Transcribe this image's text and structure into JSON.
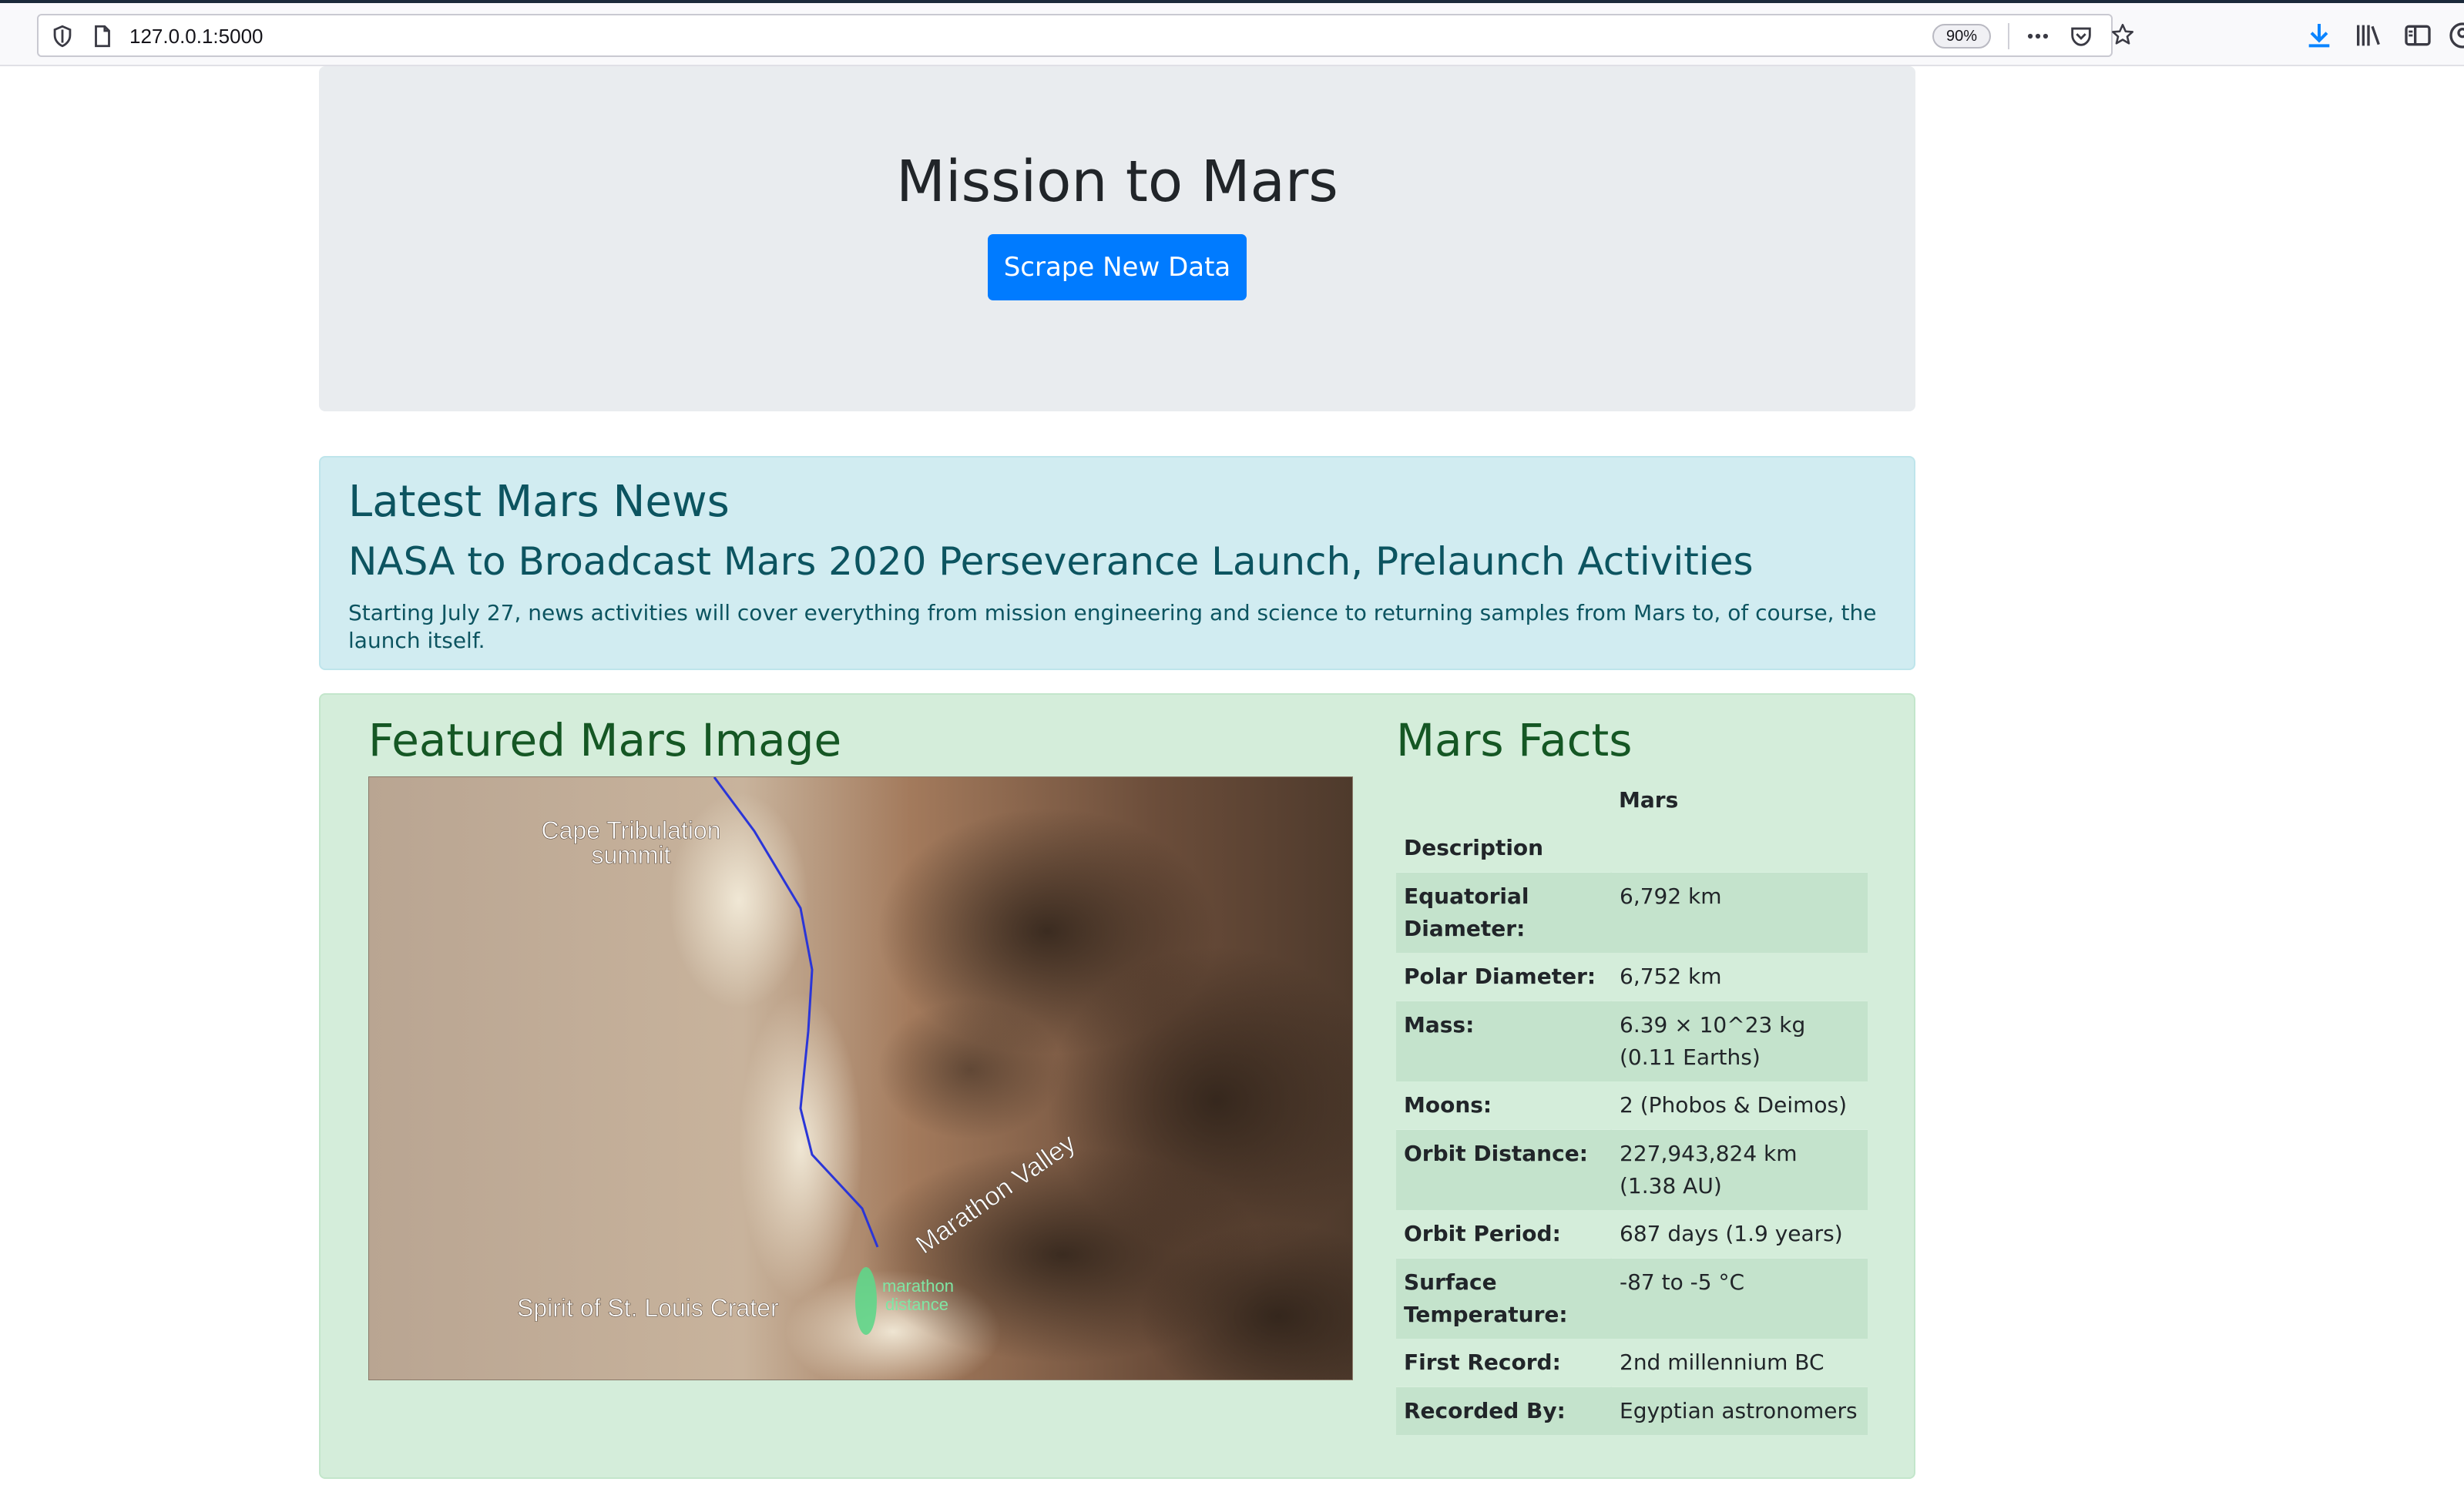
{
  "browser": {
    "url": "127.0.0.1:5000",
    "zoom": "90%",
    "icons": [
      "shield-icon",
      "page-icon",
      "more-icon",
      "pocket-icon",
      "star-icon",
      "download-icon",
      "library-icon",
      "sidebar-icon",
      "account-icon"
    ]
  },
  "header": {
    "title": "Mission to Mars",
    "scrape_label": "Scrape New Data",
    "button_color": "#007bff"
  },
  "news": {
    "heading": "Latest Mars News",
    "title": "NASA to Broadcast Mars 2020 Perseverance Launch, Prelaunch Activities",
    "teaser": "Starting July 27, news activities will cover everything from mission engineering and science to returning samples from Mars to, of course, the launch itself."
  },
  "featured": {
    "heading": "Featured Mars Image",
    "image_labels": {
      "cape": "Cape Tribulation",
      "summit": "summit",
      "valley": "Marathon Valley",
      "crater": "Spirit of St. Louis Crater",
      "marathon": "marathon",
      "distance": "distance"
    }
  },
  "facts": {
    "heading": "Mars Facts",
    "column_header": "Mars",
    "rows": [
      {
        "label": "Description",
        "value": ""
      },
      {
        "label": "Equatorial Diameter:",
        "value": "6,792 km"
      },
      {
        "label": "Polar Diameter:",
        "value": "6,752 km"
      },
      {
        "label": "Mass:",
        "value": "6.39 × 10^23 kg (0.11 Earths)"
      },
      {
        "label": "Moons:",
        "value": "2 (Phobos & Deimos)"
      },
      {
        "label": "Orbit Distance:",
        "value": "227,943,824 km (1.38 AU)"
      },
      {
        "label": "Orbit Period:",
        "value": "687 days (1.9 years)"
      },
      {
        "label": "Surface Temperature:",
        "value": "-87 to -5 °C"
      },
      {
        "label": "First Record:",
        "value": "2nd millennium BC"
      },
      {
        "label": "Recorded By:",
        "value": "Egyptian astronomers"
      }
    ]
  }
}
